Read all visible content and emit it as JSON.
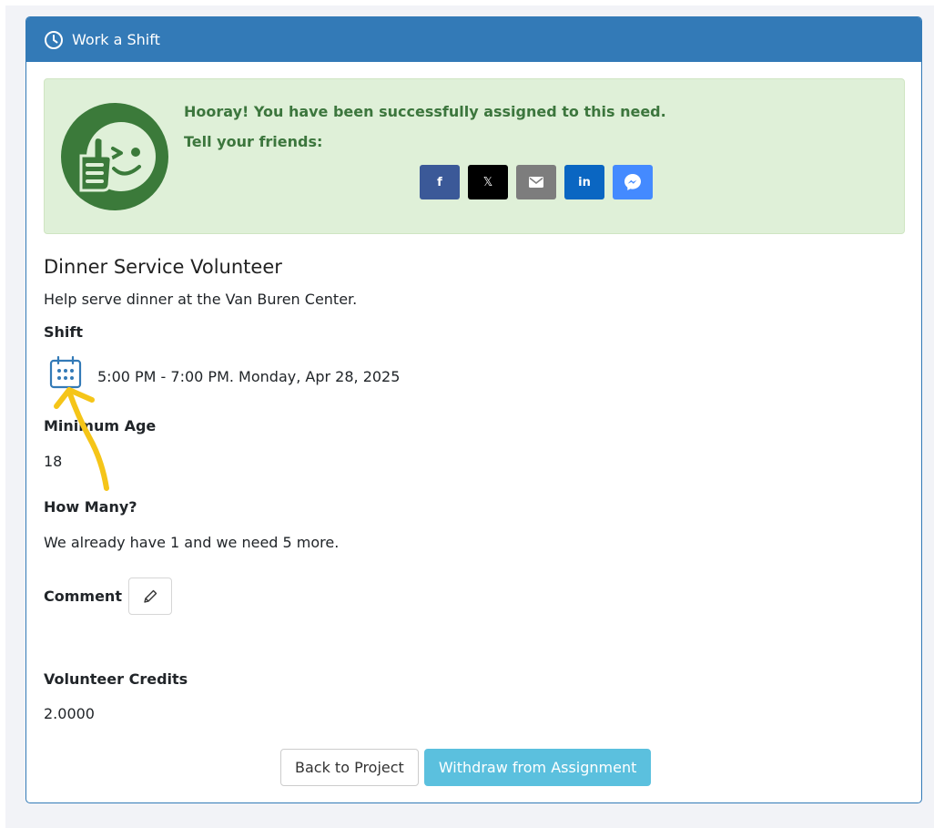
{
  "panel": {
    "heading": "Work a Shift",
    "heading_icon": "clock-icon"
  },
  "alert": {
    "message": "Hooray! You have been successfully assigned to this need.",
    "share_prompt": "Tell your friends:",
    "badge_icon": "thumbs-up-wink-icon",
    "share_buttons": [
      {
        "network": "facebook",
        "glyph": "f",
        "color": "#3b5998"
      },
      {
        "network": "x",
        "glyph": "𝕏",
        "color": "#000000"
      },
      {
        "network": "email",
        "glyph": "envelope",
        "color": "#7d7d7d"
      },
      {
        "network": "linkedin",
        "glyph": "in",
        "color": "#0a66c2"
      },
      {
        "network": "messenger",
        "glyph": "messenger",
        "color": "#448aff"
      }
    ]
  },
  "need": {
    "title": "Dinner Service Volunteer",
    "description": "Help serve dinner at the Van Buren Center.",
    "shift_label": "Shift",
    "shift_time": "5:00 PM - 7:00 PM. Monday, Apr 28, 2025",
    "min_age_label": "Minimum Age",
    "min_age": "18",
    "how_many_label": "How Many?",
    "how_many": "We already have 1 and we need 5 more.",
    "comment_label": "Comment",
    "credits_label": "Volunteer Credits",
    "credits": "2.0000"
  },
  "actions": {
    "back": "Back to Project",
    "withdraw": "Withdraw from Assignment"
  },
  "colors": {
    "primary": "#337ab7",
    "success_bg": "#dff0d8",
    "success_text": "#3c763d",
    "info": "#5bc0de",
    "annotation": "#f5c518"
  }
}
